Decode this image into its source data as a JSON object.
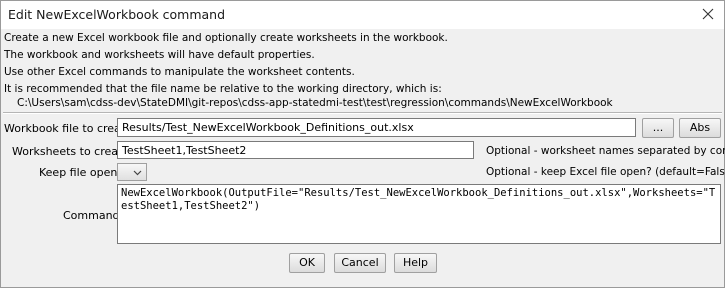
{
  "window": {
    "title": "Edit NewExcelWorkbook command"
  },
  "description": [
    "Create a new Excel workbook file and optionally create worksheets in the workbook.",
    "The workbook and worksheets will have default properties.",
    "Use other Excel commands to manipulate the worksheet contents.",
    "It is recommended that the file name be relative to the working directory, which is:",
    "C:\\Users\\sam\\cdss-dev\\StateDMI\\git-repos\\cdss-app-statedmi-test\\test\\regression\\commands\\NewExcelWorkbook"
  ],
  "form": {
    "workbook_label": "Workbook file to create:",
    "workbook_value": "Results/Test_NewExcelWorkbook_Definitions_out.xlsx",
    "browse_label": "...",
    "abs_label": "Abs",
    "worksheets_label": "Worksheets to create:",
    "worksheets_value": "TestSheet1,TestSheet2",
    "worksheets_note": "Optional - worksheet names separated by commas.",
    "keep_open_label": "Keep file open?:",
    "keep_open_value": "",
    "keep_open_note": "Optional - keep Excel file open? (default=False).",
    "command_label": "Command:",
    "command_text": "NewExcelWorkbook(OutputFile=\"Results/Test_NewExcelWorkbook_Definitions_out.xlsx\",Worksheets=\"TestSheet1,TestSheet2\")"
  },
  "buttons": {
    "ok": "OK",
    "cancel": "Cancel",
    "help": "Help"
  },
  "icons": {
    "close": "close-icon",
    "dropdown": "chevron-down-icon"
  }
}
